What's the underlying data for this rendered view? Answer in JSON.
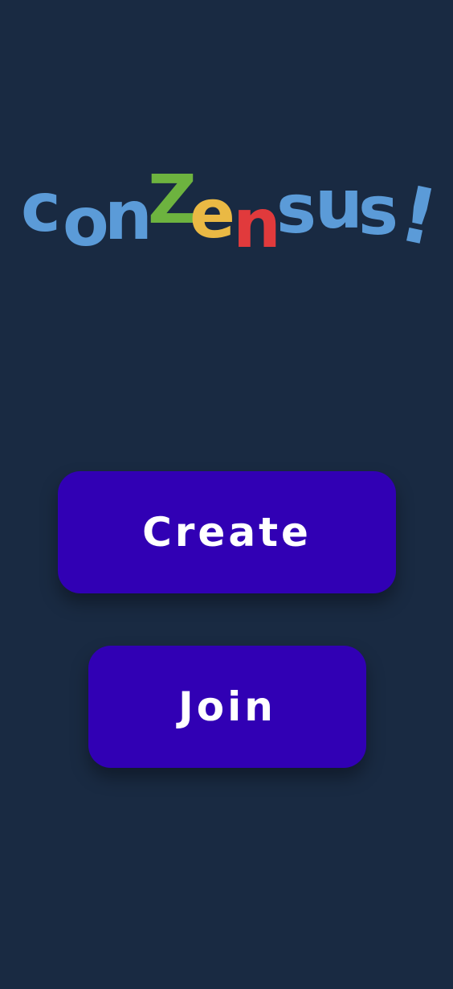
{
  "logo": {
    "text": "conzensus!",
    "letters": [
      {
        "char": "c",
        "color": "#5b9bd8"
      },
      {
        "char": "o",
        "color": "#5b9bd8"
      },
      {
        "char": "n",
        "color": "#5b9bd8"
      },
      {
        "char": "Z",
        "color": "#6db33f"
      },
      {
        "char": "e",
        "color": "#eab944"
      },
      {
        "char": "n",
        "color": "#e13a3c"
      },
      {
        "char": "s",
        "color": "#5b9bd8"
      },
      {
        "char": "u",
        "color": "#5b9bd8"
      },
      {
        "char": "s",
        "color": "#5b9bd8"
      },
      {
        "char": "!",
        "color": "#5b9bd8"
      }
    ]
  },
  "buttons": {
    "create_label": "Create",
    "join_label": "Join"
  },
  "colors": {
    "background": "#192a42",
    "button": "#3100b4",
    "button_text": "#ffffff"
  }
}
